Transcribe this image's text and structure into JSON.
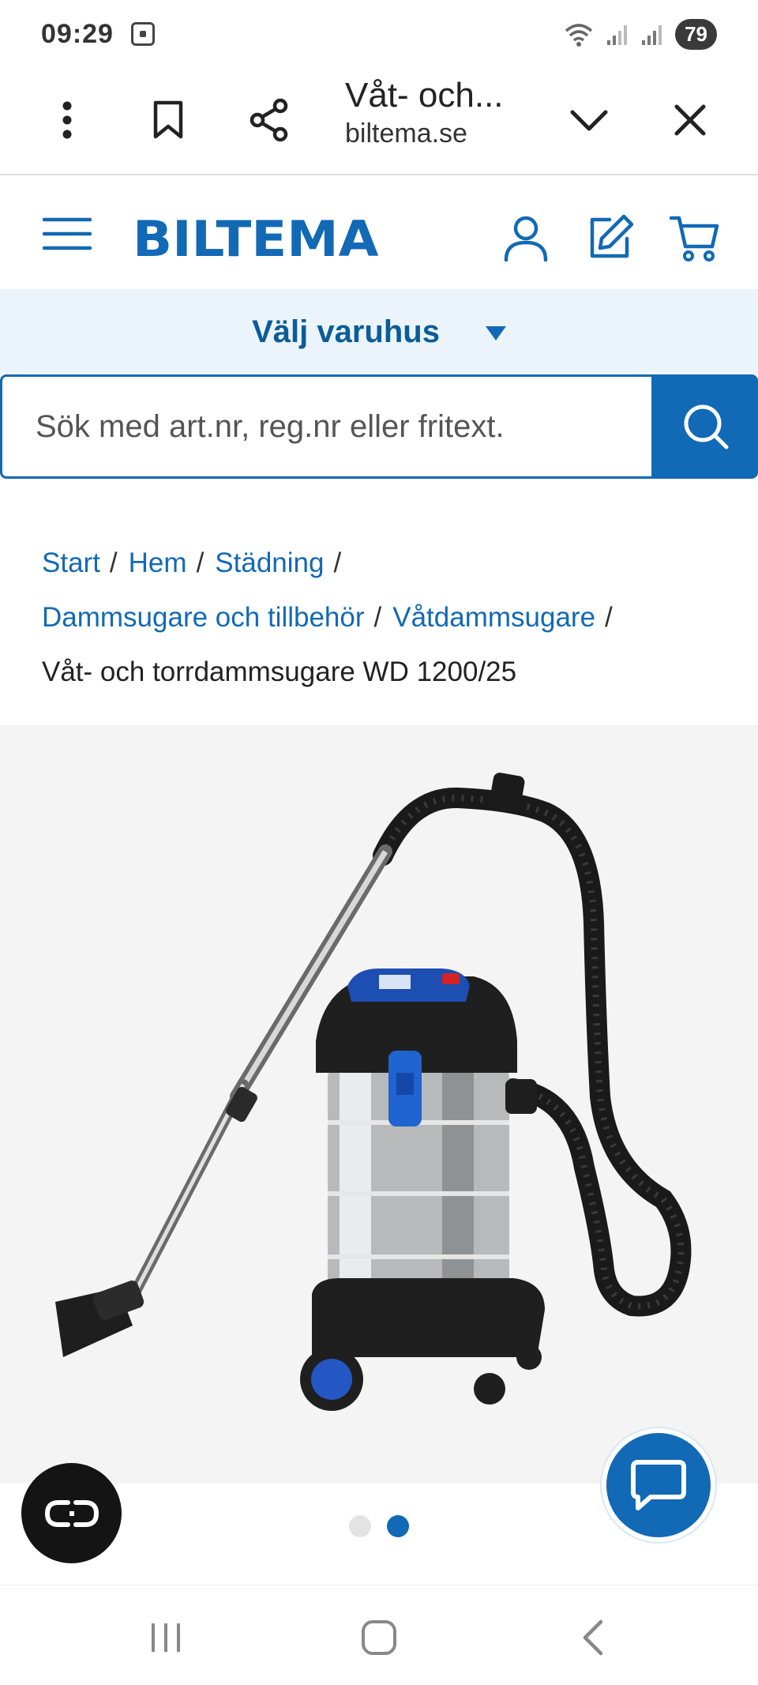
{
  "status_bar": {
    "time": "09:29",
    "battery": "79",
    "icons": [
      "screen-record-icon",
      "wifi-icon",
      "signal-icon",
      "signal-icon"
    ]
  },
  "tab_bar": {
    "title": "Våt- och...",
    "url": "biltema.se",
    "icons": [
      "more-vertical-icon",
      "bookmark-icon",
      "share-icon",
      "chevron-down-icon",
      "close-icon"
    ]
  },
  "header": {
    "logo": "BILTEMA",
    "icons": [
      "menu-icon",
      "user-icon",
      "edit-icon",
      "cart-icon"
    ]
  },
  "store_selector": {
    "label": "Välj varuhus"
  },
  "search": {
    "placeholder": "Sök med art.nr, reg.nr eller fritext.",
    "value": ""
  },
  "breadcrumb": {
    "items": [
      "Start",
      "Hem",
      "Städning",
      "Dammsugare och tillbehör",
      "Våtdammsugare"
    ],
    "separator": "/",
    "current": "Våt- och torrdammsugare WD 1200/25"
  },
  "carousel": {
    "total": 2,
    "active_index": 1
  },
  "colors": {
    "brand_blue": "#1269b5",
    "store_bar_bg": "#eaf4fa",
    "image_bg": "#f4f4f4"
  }
}
